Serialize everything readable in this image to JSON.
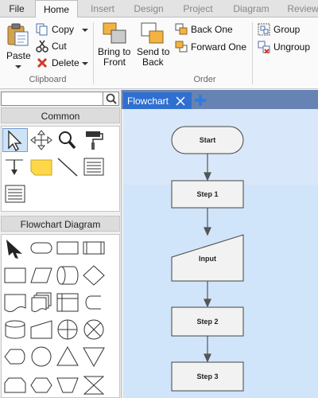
{
  "ribbon_tabs": [
    {
      "label": "File"
    },
    {
      "label": "Home"
    },
    {
      "label": "Insert"
    },
    {
      "label": "Design"
    },
    {
      "label": "Project"
    },
    {
      "label": "Diagram"
    },
    {
      "label": "Review"
    }
  ],
  "active_tab": "Home",
  "clipboard": {
    "group_label": "Clipboard",
    "paste_label": "Paste",
    "copy_label": "Copy",
    "cut_label": "Cut",
    "delete_label": "Delete"
  },
  "order": {
    "group_label": "Order",
    "bring_front_line1": "Bring to",
    "bring_front_line2": "Front",
    "send_back_line1": "Send to",
    "send_back_line2": "Back",
    "back_one_label": "Back One",
    "forward_one_label": "Forward One",
    "group_label_btn": "Group",
    "ungroup_label": "Ungroup"
  },
  "left_panel": {
    "search_placeholder": "",
    "common_header": "Common",
    "common_tools": [
      "pointer-tool",
      "pan-tool",
      "zoom-tool",
      "format-painter-tool",
      "connector-tool",
      "sticky-note-tool",
      "line-tool",
      "text-block-tool",
      "text-list-tool"
    ],
    "flowchart_header": "Flowchart Diagram",
    "flowchart_shapes": [
      "pointer",
      "terminator",
      "process",
      "predefined-process",
      "process-rect",
      "data",
      "stored-data",
      "decision",
      "document",
      "multi-document",
      "internal-storage",
      "delay",
      "database",
      "manual-input",
      "summing-junction",
      "or-junction",
      "display",
      "connector",
      "extract",
      "merge",
      "loop-limit",
      "preparation",
      "off-page",
      "collate"
    ]
  },
  "document": {
    "tab_title": "Flowchart",
    "nodes": [
      {
        "label": "Start",
        "shape": "terminator"
      },
      {
        "label": "Step 1",
        "shape": "process"
      },
      {
        "label": "Input",
        "shape": "manual-input"
      },
      {
        "label": "Step 2",
        "shape": "process"
      },
      {
        "label": "Step 3",
        "shape": "process"
      }
    ]
  },
  "colors": {
    "doc_tab_bg": "#2f6fd0",
    "doc_tabbar_bg": "#6683b3",
    "canvas_bg": "#d8e8fa",
    "selected_tool": "#cfe3f7"
  }
}
